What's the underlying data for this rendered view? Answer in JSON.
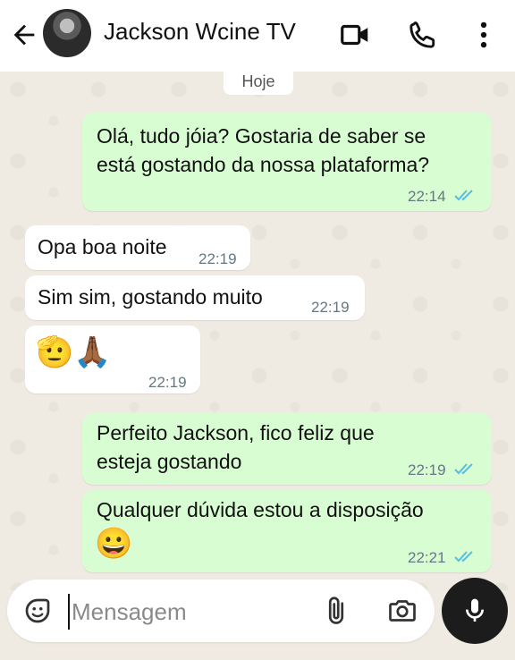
{
  "header": {
    "contact_name": "Jackson Wcine TV",
    "icons": [
      "back-arrow-icon",
      "avatar",
      "video-call-icon",
      "phone-icon",
      "more-vert-icon"
    ]
  },
  "chat": {
    "date_label": "Hoje",
    "messages": [
      {
        "direction": "out",
        "lines": [
          "Olá, tudo jóia? Gostaria de saber se",
          "está gostando da nossa plataforma?"
        ],
        "time": "22:14",
        "status": "read"
      },
      {
        "direction": "in",
        "text": "Opa boa noite",
        "time": "22:19"
      },
      {
        "direction": "in",
        "text": "Sim sim, gostando muito",
        "time": "22:19"
      },
      {
        "direction": "in",
        "emoji": "🫡🙏🏾",
        "time": "22:19"
      },
      {
        "direction": "out",
        "lines": [
          "Perfeito Jackson, fico feliz que",
          "esteja gostando"
        ],
        "time": "22:19",
        "status": "read"
      },
      {
        "direction": "out",
        "lines": [
          "Qualquer dúvida estou a disposição"
        ],
        "emoji": "😀",
        "time": "22:21",
        "status": "read"
      }
    ]
  },
  "input": {
    "placeholder": "Mensagem"
  },
  "colors": {
    "outgoing_bubble": "#d9fdd3",
    "incoming_bubble": "#ffffff",
    "read_ticks": "#53bdeb",
    "chat_background": "#efeae2",
    "mic_button": "#1c1c1c"
  }
}
